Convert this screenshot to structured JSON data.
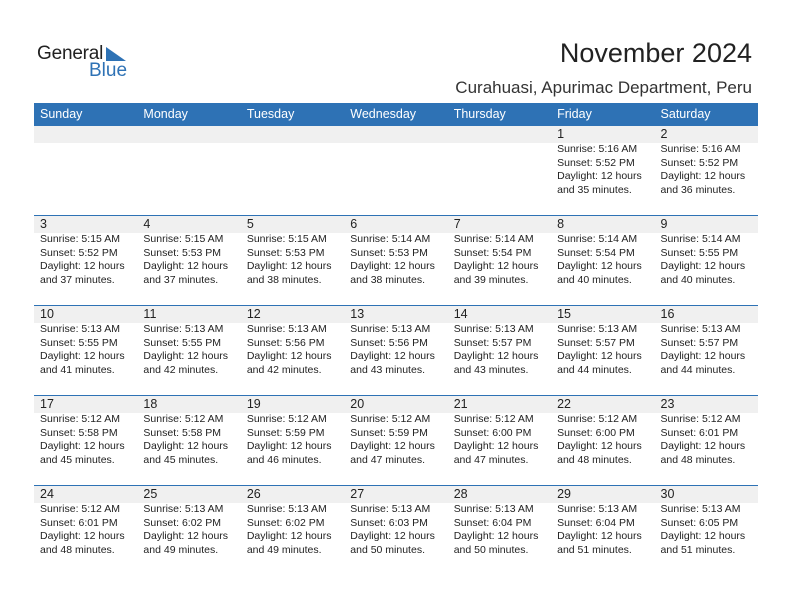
{
  "logo": {
    "line1": "General",
    "line2": "Blue",
    "accent_color": "#2e72b5"
  },
  "header": {
    "title": "November 2024",
    "location": "Curahuasi, Apurimac Department, Peru"
  },
  "weekdays": [
    "Sunday",
    "Monday",
    "Tuesday",
    "Wednesday",
    "Thursday",
    "Friday",
    "Saturday"
  ],
  "weeks": [
    [
      null,
      null,
      null,
      null,
      null,
      {
        "day": "1",
        "sunrise": "Sunrise: 5:16 AM",
        "sunset": "Sunset: 5:52 PM",
        "daylight1": "Daylight: 12 hours",
        "daylight2": "and 35 minutes."
      },
      {
        "day": "2",
        "sunrise": "Sunrise: 5:16 AM",
        "sunset": "Sunset: 5:52 PM",
        "daylight1": "Daylight: 12 hours",
        "daylight2": "and 36 minutes."
      }
    ],
    [
      {
        "day": "3",
        "sunrise": "Sunrise: 5:15 AM",
        "sunset": "Sunset: 5:52 PM",
        "daylight1": "Daylight: 12 hours",
        "daylight2": "and 37 minutes."
      },
      {
        "day": "4",
        "sunrise": "Sunrise: 5:15 AM",
        "sunset": "Sunset: 5:53 PM",
        "daylight1": "Daylight: 12 hours",
        "daylight2": "and 37 minutes."
      },
      {
        "day": "5",
        "sunrise": "Sunrise: 5:15 AM",
        "sunset": "Sunset: 5:53 PM",
        "daylight1": "Daylight: 12 hours",
        "daylight2": "and 38 minutes."
      },
      {
        "day": "6",
        "sunrise": "Sunrise: 5:14 AM",
        "sunset": "Sunset: 5:53 PM",
        "daylight1": "Daylight: 12 hours",
        "daylight2": "and 38 minutes."
      },
      {
        "day": "7",
        "sunrise": "Sunrise: 5:14 AM",
        "sunset": "Sunset: 5:54 PM",
        "daylight1": "Daylight: 12 hours",
        "daylight2": "and 39 minutes."
      },
      {
        "day": "8",
        "sunrise": "Sunrise: 5:14 AM",
        "sunset": "Sunset: 5:54 PM",
        "daylight1": "Daylight: 12 hours",
        "daylight2": "and 40 minutes."
      },
      {
        "day": "9",
        "sunrise": "Sunrise: 5:14 AM",
        "sunset": "Sunset: 5:55 PM",
        "daylight1": "Daylight: 12 hours",
        "daylight2": "and 40 minutes."
      }
    ],
    [
      {
        "day": "10",
        "sunrise": "Sunrise: 5:13 AM",
        "sunset": "Sunset: 5:55 PM",
        "daylight1": "Daylight: 12 hours",
        "daylight2": "and 41 minutes."
      },
      {
        "day": "11",
        "sunrise": "Sunrise: 5:13 AM",
        "sunset": "Sunset: 5:55 PM",
        "daylight1": "Daylight: 12 hours",
        "daylight2": "and 42 minutes."
      },
      {
        "day": "12",
        "sunrise": "Sunrise: 5:13 AM",
        "sunset": "Sunset: 5:56 PM",
        "daylight1": "Daylight: 12 hours",
        "daylight2": "and 42 minutes."
      },
      {
        "day": "13",
        "sunrise": "Sunrise: 5:13 AM",
        "sunset": "Sunset: 5:56 PM",
        "daylight1": "Daylight: 12 hours",
        "daylight2": "and 43 minutes."
      },
      {
        "day": "14",
        "sunrise": "Sunrise: 5:13 AM",
        "sunset": "Sunset: 5:57 PM",
        "daylight1": "Daylight: 12 hours",
        "daylight2": "and 43 minutes."
      },
      {
        "day": "15",
        "sunrise": "Sunrise: 5:13 AM",
        "sunset": "Sunset: 5:57 PM",
        "daylight1": "Daylight: 12 hours",
        "daylight2": "and 44 minutes."
      },
      {
        "day": "16",
        "sunrise": "Sunrise: 5:13 AM",
        "sunset": "Sunset: 5:57 PM",
        "daylight1": "Daylight: 12 hours",
        "daylight2": "and 44 minutes."
      }
    ],
    [
      {
        "day": "17",
        "sunrise": "Sunrise: 5:12 AM",
        "sunset": "Sunset: 5:58 PM",
        "daylight1": "Daylight: 12 hours",
        "daylight2": "and 45 minutes."
      },
      {
        "day": "18",
        "sunrise": "Sunrise: 5:12 AM",
        "sunset": "Sunset: 5:58 PM",
        "daylight1": "Daylight: 12 hours",
        "daylight2": "and 45 minutes."
      },
      {
        "day": "19",
        "sunrise": "Sunrise: 5:12 AM",
        "sunset": "Sunset: 5:59 PM",
        "daylight1": "Daylight: 12 hours",
        "daylight2": "and 46 minutes."
      },
      {
        "day": "20",
        "sunrise": "Sunrise: 5:12 AM",
        "sunset": "Sunset: 5:59 PM",
        "daylight1": "Daylight: 12 hours",
        "daylight2": "and 47 minutes."
      },
      {
        "day": "21",
        "sunrise": "Sunrise: 5:12 AM",
        "sunset": "Sunset: 6:00 PM",
        "daylight1": "Daylight: 12 hours",
        "daylight2": "and 47 minutes."
      },
      {
        "day": "22",
        "sunrise": "Sunrise: 5:12 AM",
        "sunset": "Sunset: 6:00 PM",
        "daylight1": "Daylight: 12 hours",
        "daylight2": "and 48 minutes."
      },
      {
        "day": "23",
        "sunrise": "Sunrise: 5:12 AM",
        "sunset": "Sunset: 6:01 PM",
        "daylight1": "Daylight: 12 hours",
        "daylight2": "and 48 minutes."
      }
    ],
    [
      {
        "day": "24",
        "sunrise": "Sunrise: 5:12 AM",
        "sunset": "Sunset: 6:01 PM",
        "daylight1": "Daylight: 12 hours",
        "daylight2": "and 48 minutes."
      },
      {
        "day": "25",
        "sunrise": "Sunrise: 5:13 AM",
        "sunset": "Sunset: 6:02 PM",
        "daylight1": "Daylight: 12 hours",
        "daylight2": "and 49 minutes."
      },
      {
        "day": "26",
        "sunrise": "Sunrise: 5:13 AM",
        "sunset": "Sunset: 6:02 PM",
        "daylight1": "Daylight: 12 hours",
        "daylight2": "and 49 minutes."
      },
      {
        "day": "27",
        "sunrise": "Sunrise: 5:13 AM",
        "sunset": "Sunset: 6:03 PM",
        "daylight1": "Daylight: 12 hours",
        "daylight2": "and 50 minutes."
      },
      {
        "day": "28",
        "sunrise": "Sunrise: 5:13 AM",
        "sunset": "Sunset: 6:04 PM",
        "daylight1": "Daylight: 12 hours",
        "daylight2": "and 50 minutes."
      },
      {
        "day": "29",
        "sunrise": "Sunrise: 5:13 AM",
        "sunset": "Sunset: 6:04 PM",
        "daylight1": "Daylight: 12 hours",
        "daylight2": "and 51 minutes."
      },
      {
        "day": "30",
        "sunrise": "Sunrise: 5:13 AM",
        "sunset": "Sunset: 6:05 PM",
        "daylight1": "Daylight: 12 hours",
        "daylight2": "and 51 minutes."
      }
    ]
  ]
}
